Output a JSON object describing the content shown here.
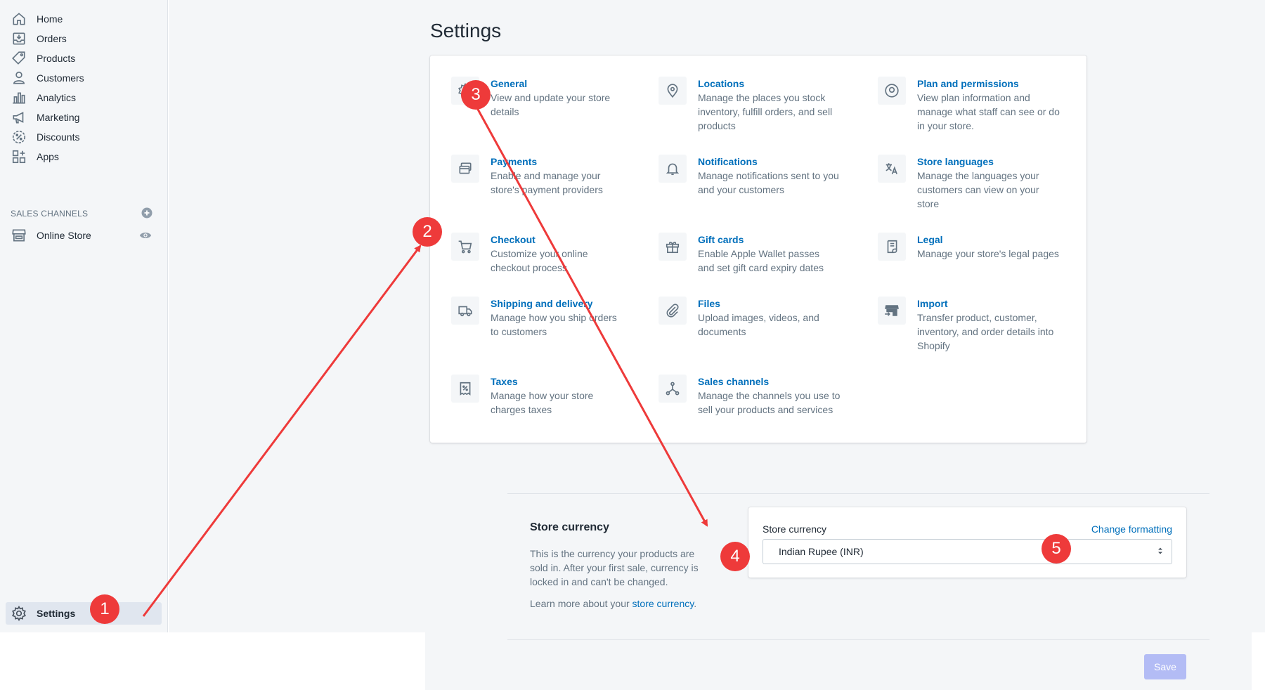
{
  "colors": {
    "link": "#006fbb",
    "sidebar_bg": "#f4f6f8",
    "annotation": "#ee3a3a",
    "save_disabled": "#b3bcf5"
  },
  "sidebar": {
    "items": [
      {
        "label": "Home",
        "icon": "home-icon"
      },
      {
        "label": "Orders",
        "icon": "orders-icon"
      },
      {
        "label": "Products",
        "icon": "tag-icon"
      },
      {
        "label": "Customers",
        "icon": "person-icon"
      },
      {
        "label": "Analytics",
        "icon": "bar-chart-icon"
      },
      {
        "label": "Marketing",
        "icon": "megaphone-icon"
      },
      {
        "label": "Discounts",
        "icon": "discount-icon"
      },
      {
        "label": "Apps",
        "icon": "apps-icon"
      }
    ],
    "sales_channels": {
      "header": "SALES CHANNELS",
      "online_store": "Online Store"
    },
    "settings_label": "Settings"
  },
  "page": {
    "title": "Settings"
  },
  "settings": [
    {
      "title": "General",
      "desc": "View and update your store details",
      "icon": "gear-icon"
    },
    {
      "title": "Locations",
      "desc": "Manage the places you stock inventory, fulfill orders, and sell products",
      "icon": "location-pin-icon"
    },
    {
      "title": "Plan and permissions",
      "desc": "View plan information and manage what staff can see or do in your store.",
      "icon": "person-circle-icon"
    },
    {
      "title": "Payments",
      "desc": "Enable and manage your store's payment providers",
      "icon": "payments-icon"
    },
    {
      "title": "Notifications",
      "desc": "Manage notifications sent to you and your customers",
      "icon": "bell-icon"
    },
    {
      "title": "Store languages",
      "desc": "Manage the languages your customers can view on your store",
      "icon": "translate-icon"
    },
    {
      "title": "Checkout",
      "desc": "Customize your online checkout process",
      "icon": "cart-icon"
    },
    {
      "title": "Gift cards",
      "desc": "Enable Apple Wallet passes and set gift card expiry dates",
      "icon": "gift-icon"
    },
    {
      "title": "Legal",
      "desc": "Manage your store's legal pages",
      "icon": "legal-document-icon"
    },
    {
      "title": "Shipping and delivery",
      "desc": "Manage how you ship orders to customers",
      "icon": "truck-icon"
    },
    {
      "title": "Files",
      "desc": "Upload images, videos, and documents",
      "icon": "paperclip-icon"
    },
    {
      "title": "Import",
      "desc": "Transfer product, customer, inventory, and order details into Shopify",
      "icon": "import-icon"
    },
    {
      "title": "Taxes",
      "desc": "Manage how your store charges taxes",
      "icon": "tax-icon"
    },
    {
      "title": "Sales channels",
      "desc": "Manage the channels you use to sell your products and services",
      "icon": "channels-icon"
    }
  ],
  "currency": {
    "section_title": "Store currency",
    "description": "This is the currency your products are sold in. After your first sale, currency is locked in and can't be changed.",
    "learn_more_prefix": "Learn more about your ",
    "learn_more_link": "store currency",
    "learn_more_suffix": ".",
    "field_label": "Store currency",
    "change_formatting": "Change formatting",
    "selected_value": "Indian Rupee (INR)"
  },
  "save_button": "Save",
  "annotations": {
    "badges": [
      "1",
      "2",
      "3",
      "4",
      "5"
    ]
  }
}
